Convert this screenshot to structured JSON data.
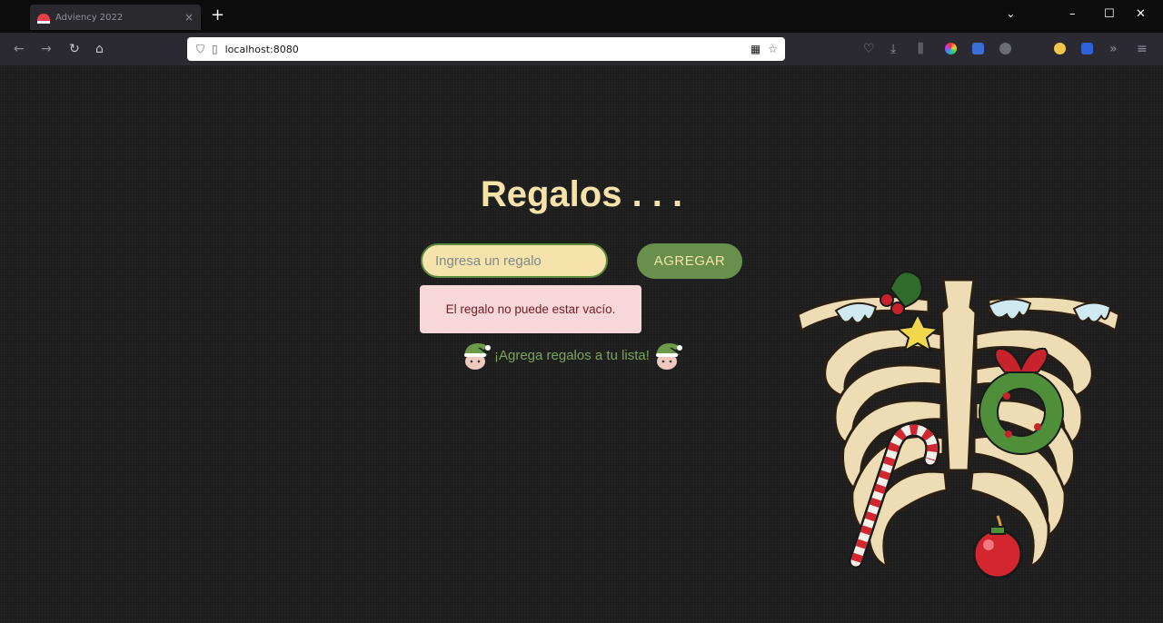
{
  "browser": {
    "tab_title": "Adviency 2022",
    "tab_close": "×",
    "new_tab": "+",
    "url": "localhost:8080"
  },
  "app": {
    "title": "Regalos . . .",
    "input_placeholder": "Ingresa un regalo",
    "input_value": "",
    "add_button": "AGREGAR",
    "error_message": "El regalo no puede estar vacío.",
    "empty_message": "¡Agrega regalos a tu lista!"
  },
  "colors": {
    "title": "#f7e3a9",
    "accent_green": "#698f4d",
    "error_bg": "#f8d7da",
    "error_text": "#721c24"
  }
}
